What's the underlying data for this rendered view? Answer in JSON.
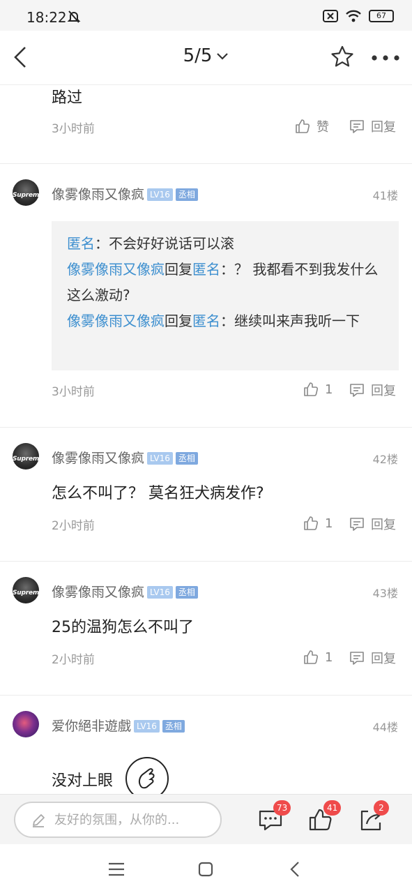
{
  "status_bar": {
    "time": "18:22",
    "battery": "67"
  },
  "nav": {
    "page": "5/5"
  },
  "comments": [
    {
      "content": "路过",
      "time": "3小时前",
      "like_label": "赞",
      "reply_label": "回复"
    },
    {
      "username": "像雾像雨又像疯",
      "level": "LV16",
      "title": "丞相",
      "floor": "41楼",
      "avatar_text": "Suprem",
      "replies": [
        {
          "author": "匿名",
          "sep": "：",
          "text": "不会好好说话可以滚"
        },
        {
          "author": "像雾像雨又像疯",
          "verb": "回复",
          "target": "匿名",
          "sep": "：",
          "text": "？ 我都看不到我发什么 这么激动?"
        },
        {
          "author": "像雾像雨又像疯",
          "verb": "回复",
          "target": "匿名",
          "sep": "：",
          "text": "继续叫来声我听一下"
        }
      ],
      "time": "3小时前",
      "likes": "1",
      "reply_label": "回复"
    },
    {
      "username": "像雾像雨又像疯",
      "level": "LV16",
      "title": "丞相",
      "floor": "42楼",
      "avatar_text": "Suprem",
      "content": "怎么不叫了？ 莫名狂犬病发作?",
      "time": "2小时前",
      "likes": "1",
      "reply_label": "回复"
    },
    {
      "username": "像雾像雨又像疯",
      "level": "LV16",
      "title": "丞相",
      "floor": "43楼",
      "avatar_text": "Suprem",
      "content": "25的温狗怎么不叫了",
      "time": "2小时前",
      "likes": "1",
      "reply_label": "回复"
    },
    {
      "username": "爱你絕非遊戲",
      "level": "LV16",
      "title": "丞相",
      "floor": "44楼",
      "content": "没对上眼"
    }
  ],
  "input_bar": {
    "placeholder": "友好的氛围，从你的...",
    "comments_count": "73",
    "likes_count": "41",
    "shares_count": "2"
  },
  "colors": {
    "accent_blue": "#3d8fcf",
    "badge_red": "#ef4b4b"
  }
}
